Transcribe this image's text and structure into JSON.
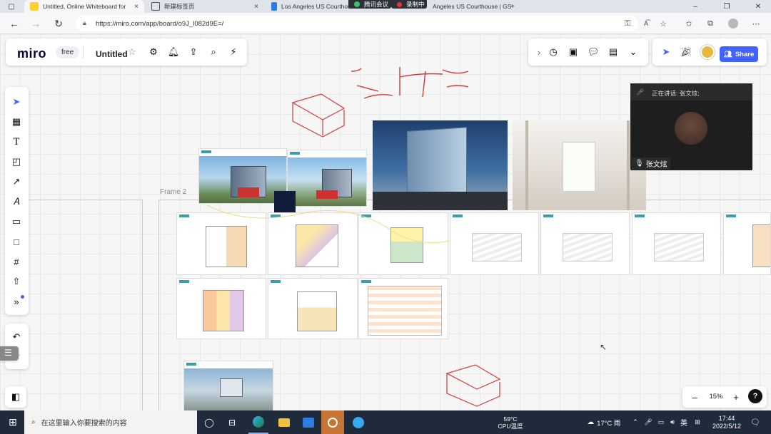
{
  "browser": {
    "tabs": [
      {
        "title": "Untitled, Online Whiteboard for",
        "close": "×",
        "active": true,
        "favicon": "miro-icon"
      },
      {
        "title": "新建标签页",
        "close": "×",
        "active": false,
        "favicon": "new-tab-icon"
      },
      {
        "title": "Los Angeles US Courthouse",
        "close": "",
        "active": false,
        "favicon": "bing-icon"
      },
      {
        "title": "腾讯会议",
        "close": "",
        "active": false,
        "favicon": "meeting-icon"
      },
      {
        "title": "录制中",
        "close": "",
        "active": false,
        "favicon": "recording-icon"
      },
      {
        "title": "Angeles US Courthouse | GS",
        "close": "×",
        "active": false,
        "favicon": "meeting-share-icon"
      }
    ],
    "new_tab": "+",
    "window_controls": [
      "–",
      "❐",
      "✕"
    ],
    "url": "https://miro.com/app/board/o9J_l082d9E=/"
  },
  "miro": {
    "logo": "miro",
    "plan_badge": "free",
    "board_name": "Untitled",
    "share_label": "Share",
    "zoom": "15%",
    "zoom_minus": "–",
    "zoom_plus": "+",
    "help": "?",
    "frame_label": "Frame 2",
    "accent": "#4262ff"
  },
  "meeting": {
    "speaking_label": "正在讲话: 张文炫;",
    "participant_name": "张文炫"
  },
  "taskbar": {
    "search_placeholder": "在这里输入你要搜索的内容",
    "temp": "59°C",
    "temp_label": "CPU温度",
    "weather": "17°C 雨",
    "ime": "英",
    "time": "17:44",
    "date": "2022/5/12"
  }
}
